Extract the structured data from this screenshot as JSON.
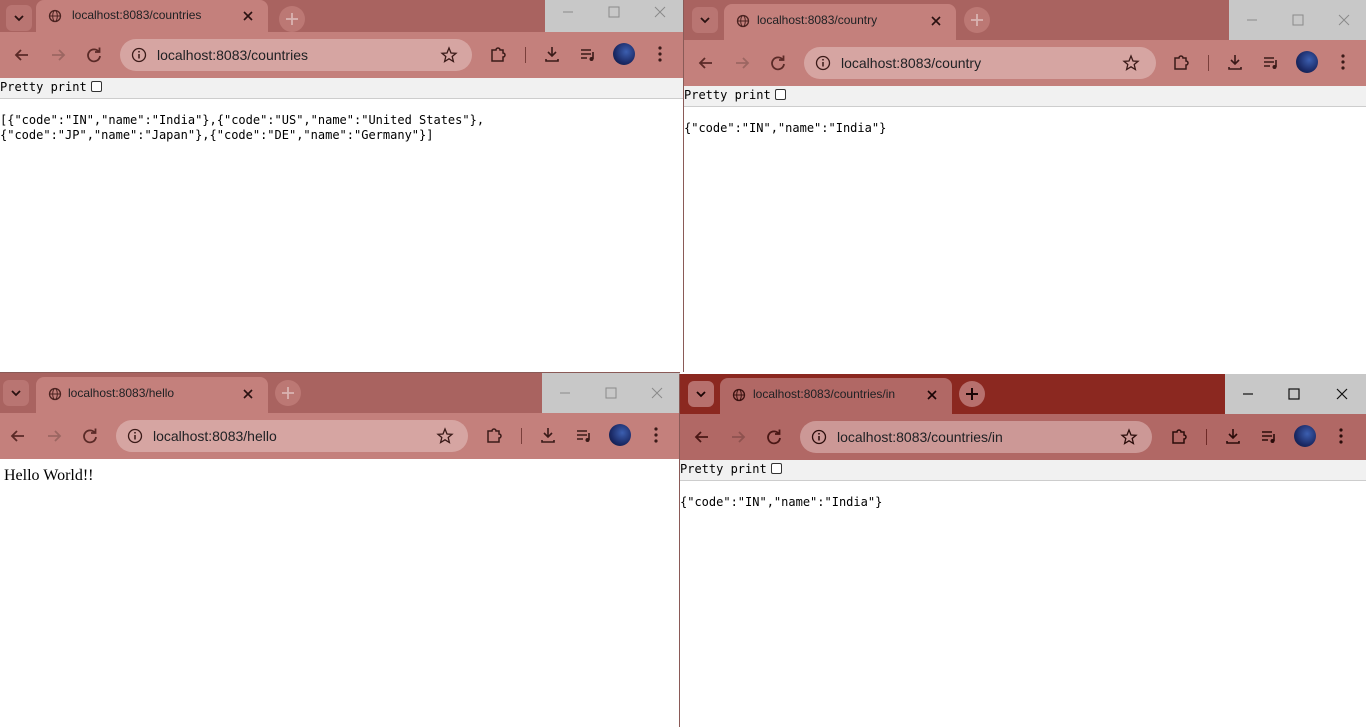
{
  "windows": [
    {
      "tab_title": "localhost:8083/countries",
      "url": "localhost:8083/countries",
      "pretty_print_label": "Pretty print",
      "body_text": "[{\"code\":\"IN\",\"name\":\"India\"},{\"code\":\"US\",\"name\":\"United States\"},\n{\"code\":\"JP\",\"name\":\"Japan\"},{\"code\":\"DE\",\"name\":\"Germany\"}]"
    },
    {
      "tab_title": "localhost:8083/country",
      "url": "localhost:8083/country",
      "pretty_print_label": "Pretty print",
      "body_text": "{\"code\":\"IN\",\"name\":\"India\"}"
    },
    {
      "tab_title": "localhost:8083/hello",
      "url": "localhost:8083/hello",
      "body_text": "Hello World!!"
    },
    {
      "tab_title": "localhost:8083/countries/in",
      "url": "localhost:8083/countries/in",
      "pretty_print_label": "Pretty print",
      "body_text": "{\"code\":\"IN\",\"name\":\"India\"}"
    }
  ],
  "colors": {
    "inactive_frame": "#a96360",
    "inactive_toolbar": "#b16c69",
    "inactive_omnibox": "#c5918e",
    "inactive_tab": "#c4807c",
    "inactive_wc": "#c8c8c8",
    "active_frame": "#8b2820",
    "active_toolbar": "#b16865",
    "active_omnibox": "#cc9896",
    "active_tab": "#b7706d"
  },
  "icons": {
    "tab_search": "chevron-down-icon",
    "favicon": "globe-icon",
    "close_tab": "close-icon",
    "new_tab": "plus-icon",
    "minimize": "minimize-icon",
    "maximize": "maximize-icon",
    "close_window": "close-icon",
    "back": "arrow-left-icon",
    "forward": "arrow-right-icon",
    "reload": "reload-icon",
    "site_info": "info-icon",
    "bookmark": "star-icon",
    "extensions": "puzzle-icon",
    "downloads": "download-icon",
    "media": "media-queue-icon",
    "profile": "avatar"
  }
}
